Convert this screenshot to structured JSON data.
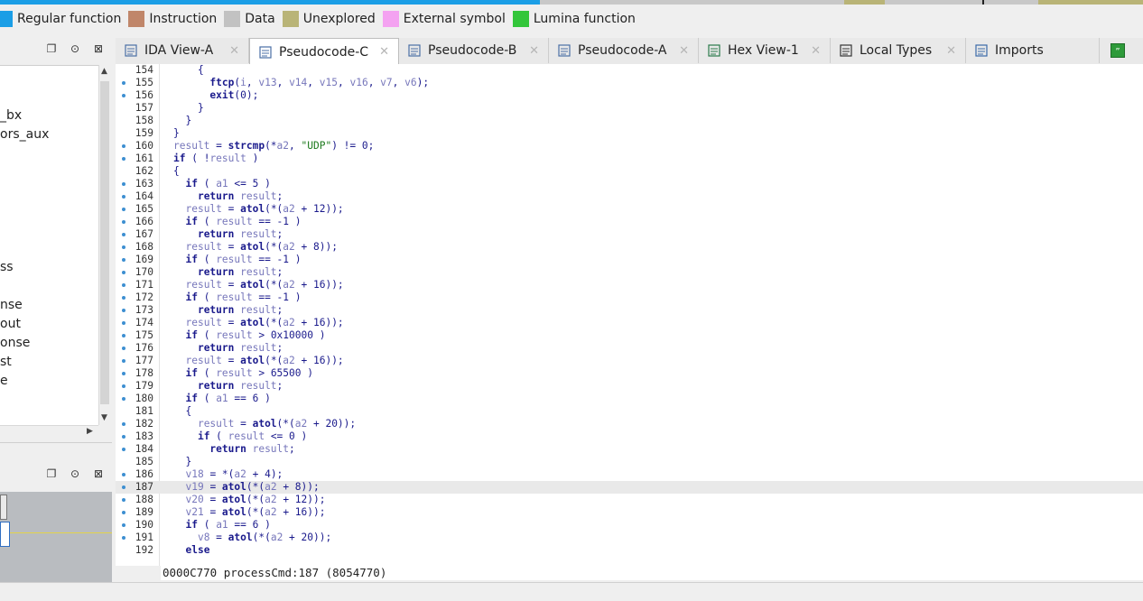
{
  "legend": [
    {
      "label": "Regular function",
      "color": "#1b9ee6"
    },
    {
      "label": "Instruction",
      "color": "#c0866a"
    },
    {
      "label": "Data",
      "color": "#c2c2c2"
    },
    {
      "label": "Unexplored",
      "color": "#b9b477"
    },
    {
      "label": "External symbol",
      "color": "#f4a2f1"
    },
    {
      "label": "Lumina function",
      "color": "#33c63a"
    }
  ],
  "functions_panel": {
    "items": [
      "_bx",
      "ors_aux",
      "ss",
      "nse",
      "out",
      "onse",
      "st",
      "e"
    ]
  },
  "tabs": [
    {
      "label": "IDA View-A",
      "icon": "ida-view-icon",
      "active": false
    },
    {
      "label": "Pseudocode-C",
      "icon": "pseudocode-icon",
      "active": true
    },
    {
      "label": "Pseudocode-B",
      "icon": "pseudocode-icon",
      "active": false
    },
    {
      "label": "Pseudocode-A",
      "icon": "pseudocode-icon",
      "active": false
    },
    {
      "label": "Hex View-1",
      "icon": "hex-view-icon",
      "active": false
    },
    {
      "label": "Local Types",
      "icon": "local-types-icon",
      "active": false
    },
    {
      "label": "Imports",
      "icon": "imports-icon",
      "active": false
    }
  ],
  "code": [
    {
      "n": "154",
      "dot": false,
      "t": "    {"
    },
    {
      "n": "155",
      "dot": true,
      "t": "      ftcp(i, v13, v14, v15, v16, v7, v6);"
    },
    {
      "n": "156",
      "dot": true,
      "t": "      exit(0);"
    },
    {
      "n": "157",
      "dot": false,
      "t": "    }"
    },
    {
      "n": "158",
      "dot": false,
      "t": "  }"
    },
    {
      "n": "159",
      "dot": false,
      "t": "}"
    },
    {
      "n": "160",
      "dot": true,
      "t": "result = strcmp(*a2, \"UDP\") != 0;"
    },
    {
      "n": "161",
      "dot": true,
      "t": "if ( !result )"
    },
    {
      "n": "162",
      "dot": false,
      "t": "{"
    },
    {
      "n": "163",
      "dot": true,
      "t": "  if ( a1 <= 5 )"
    },
    {
      "n": "164",
      "dot": true,
      "t": "    return result;"
    },
    {
      "n": "165",
      "dot": true,
      "t": "  result = atol(*(a2 + 12));"
    },
    {
      "n": "166",
      "dot": true,
      "t": "  if ( result == -1 )"
    },
    {
      "n": "167",
      "dot": true,
      "t": "    return result;"
    },
    {
      "n": "168",
      "dot": true,
      "t": "  result = atol(*(a2 + 8));"
    },
    {
      "n": "169",
      "dot": true,
      "t": "  if ( result == -1 )"
    },
    {
      "n": "170",
      "dot": true,
      "t": "    return result;"
    },
    {
      "n": "171",
      "dot": true,
      "t": "  result = atol(*(a2 + 16));"
    },
    {
      "n": "172",
      "dot": true,
      "t": "  if ( result == -1 )"
    },
    {
      "n": "173",
      "dot": true,
      "t": "    return result;"
    },
    {
      "n": "174",
      "dot": true,
      "t": "  result = atol(*(a2 + 16));"
    },
    {
      "n": "175",
      "dot": true,
      "t": "  if ( result > 0x10000 )"
    },
    {
      "n": "176",
      "dot": true,
      "t": "    return result;"
    },
    {
      "n": "177",
      "dot": true,
      "t": "  result = atol(*(a2 + 16));"
    },
    {
      "n": "178",
      "dot": true,
      "t": "  if ( result > 65500 )"
    },
    {
      "n": "179",
      "dot": true,
      "t": "    return result;"
    },
    {
      "n": "180",
      "dot": true,
      "t": "  if ( a1 == 6 )"
    },
    {
      "n": "181",
      "dot": false,
      "t": "  {"
    },
    {
      "n": "182",
      "dot": true,
      "t": "    result = atol(*(a2 + 20));"
    },
    {
      "n": "183",
      "dot": true,
      "t": "    if ( result <= 0 )"
    },
    {
      "n": "184",
      "dot": true,
      "t": "      return result;"
    },
    {
      "n": "185",
      "dot": false,
      "t": "  }"
    },
    {
      "n": "186",
      "dot": true,
      "t": "  v18 = *(a2 + 4);"
    },
    {
      "n": "187",
      "dot": true,
      "t": "  v19 = atol(*(a2 + 8));",
      "hl": true
    },
    {
      "n": "188",
      "dot": true,
      "t": "  v20 = atol(*(a2 + 12));"
    },
    {
      "n": "189",
      "dot": true,
      "t": "  v21 = atol(*(a2 + 16));"
    },
    {
      "n": "190",
      "dot": true,
      "t": "  if ( a1 == 6 )"
    },
    {
      "n": "191",
      "dot": true,
      "t": "    v8 = atol(*(a2 + 20));"
    },
    {
      "n": "192",
      "dot": false,
      "t": "  else"
    }
  ],
  "status": {
    "text": "0000C770 processCmd:187 (8054770)"
  }
}
